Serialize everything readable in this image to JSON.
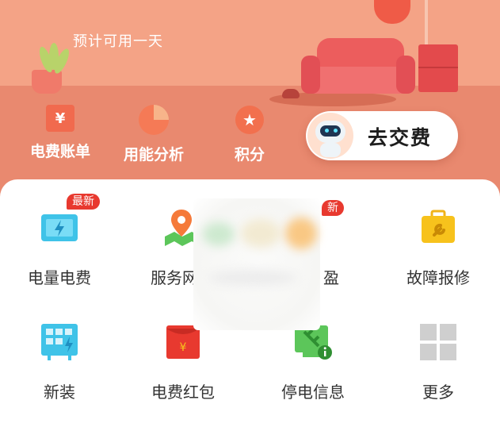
{
  "hero": {
    "balance_text": "预计可用一天",
    "quick_actions": [
      {
        "label": "电费账单",
        "icon": "bill-icon",
        "glyph": "¥"
      },
      {
        "label": "用能分析",
        "icon": "pie-chart-icon"
      },
      {
        "label": "积分",
        "icon": "star-icon",
        "glyph": "★"
      }
    ],
    "pay_button": {
      "label": "去交费",
      "icon": "robot-avatar"
    }
  },
  "services": {
    "row1": [
      {
        "label": "电量电费",
        "icon": "battery-bolt-icon",
        "badge": "最新"
      },
      {
        "label": "服务网",
        "icon": "map-pin-icon"
      },
      {
        "label": "盈",
        "icon": "service-icon",
        "badge": "新"
      },
      {
        "label": "故障报修",
        "icon": "toolbox-icon"
      }
    ],
    "row2": [
      {
        "label": "新装",
        "icon": "panel-meter-icon"
      },
      {
        "label": "电费红包",
        "icon": "red-envelope-icon",
        "glyph": "¥"
      },
      {
        "label": "停电信息",
        "icon": "outage-info-icon",
        "glyph": "i"
      },
      {
        "label": "更多",
        "icon": "grid-more-icon"
      }
    ]
  },
  "colors": {
    "accent": "#f16a4e",
    "badge": "#e8392f",
    "yellow": "#f7c21c",
    "blue": "#3fc3e8",
    "green": "#5cc65a"
  }
}
